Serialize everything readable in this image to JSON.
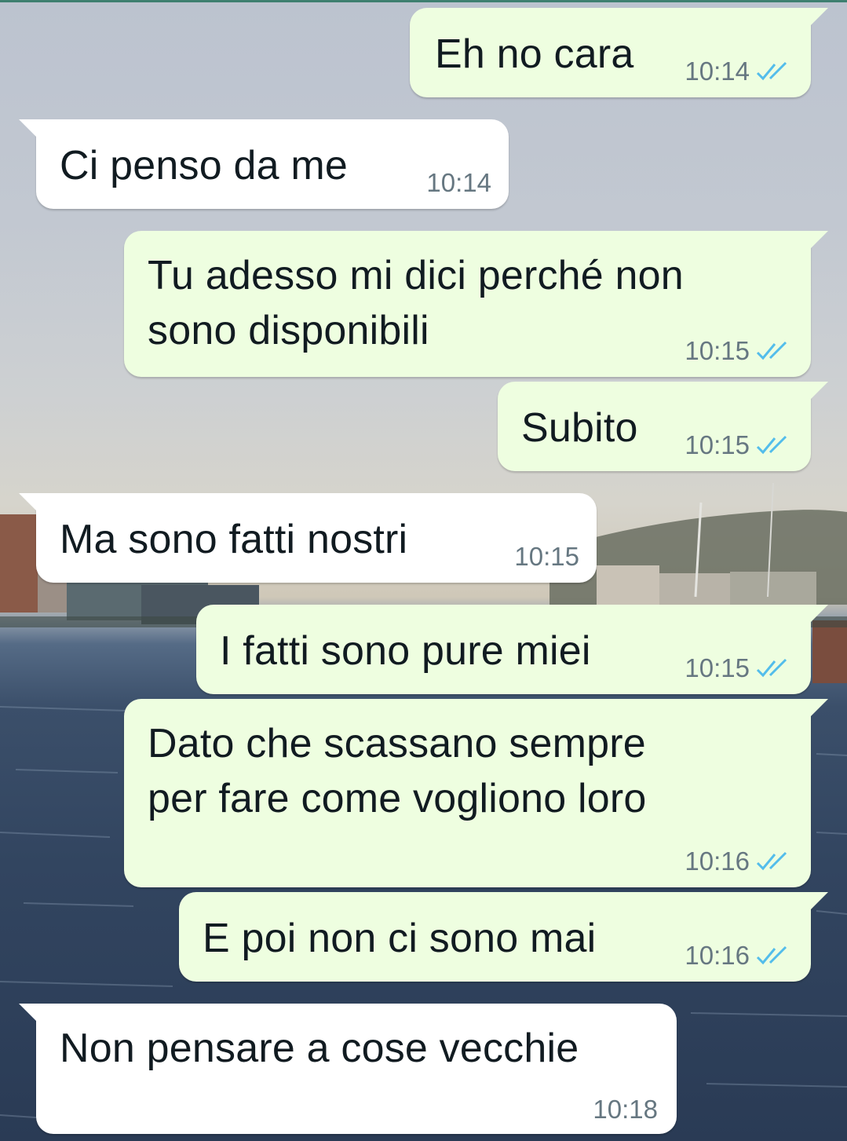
{
  "colors": {
    "outgoing_bubble": "#eefee0",
    "incoming_bubble": "#ffffff",
    "text": "#111b21",
    "timestamp": "#667781",
    "read_ticks": "#53bdeb"
  },
  "messages": [
    {
      "direction": "outgoing",
      "lines": [
        "Eh no cara"
      ],
      "time": "10:14",
      "status_icon": "double-check-read-icon"
    },
    {
      "direction": "incoming",
      "lines": [
        "Ci penso da me"
      ],
      "time": "10:14"
    },
    {
      "direction": "outgoing",
      "lines": [
        "Tu adesso mi dici perché non",
        "sono disponibili"
      ],
      "time": "10:15",
      "status_icon": "double-check-read-icon"
    },
    {
      "direction": "outgoing",
      "lines": [
        "Subito"
      ],
      "time": "10:15",
      "status_icon": "double-check-read-icon"
    },
    {
      "direction": "incoming",
      "lines": [
        "Ma sono fatti nostri"
      ],
      "time": "10:15"
    },
    {
      "direction": "outgoing",
      "lines": [
        "I fatti sono pure miei"
      ],
      "time": "10:15",
      "status_icon": "double-check-read-icon"
    },
    {
      "direction": "outgoing",
      "lines": [
        "Dato che scassano sempre",
        "per fare come vogliono loro"
      ],
      "time": "10:16",
      "status_icon": "double-check-read-icon"
    },
    {
      "direction": "outgoing",
      "lines": [
        "E poi non ci sono mai"
      ],
      "time": "10:16",
      "status_icon": "double-check-read-icon"
    },
    {
      "direction": "incoming",
      "lines": [
        "Non pensare a cose vecchie"
      ],
      "time": "10:18"
    }
  ]
}
